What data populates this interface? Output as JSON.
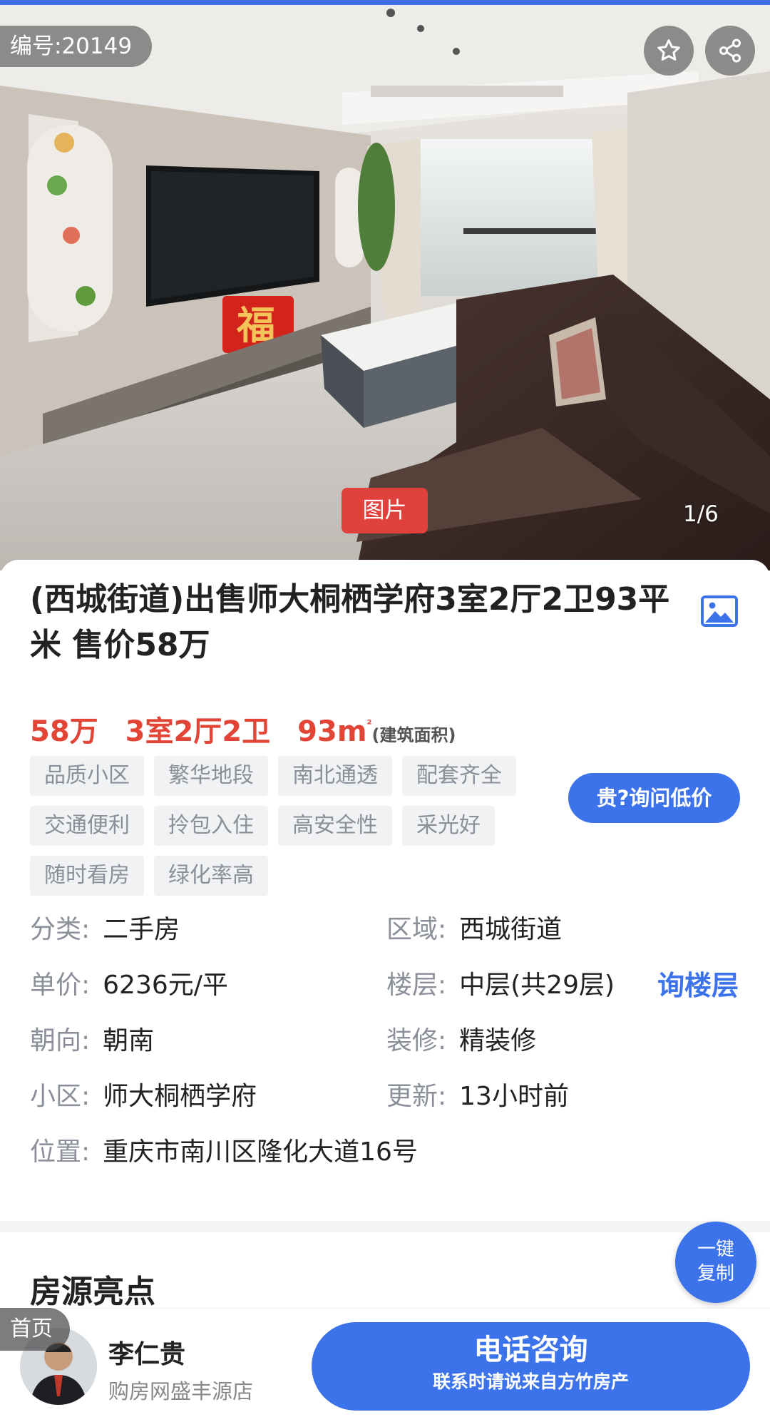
{
  "hero": {
    "listing_no": "编号:20149",
    "photo_tag": "图片",
    "photo_counter": "1/6",
    "decor_text": "福"
  },
  "listing": {
    "title": "(西城街道)出售师大桐栖学府3室2厅2卫93平米 售价58万",
    "price": "58万",
    "layout": "3室2厅2卫",
    "area": "93m",
    "area_sup": "²",
    "area_note": "(建筑面积)",
    "tags": [
      "品质小区",
      "繁华地段",
      "南北通透",
      "配套齐全",
      "交通便利",
      "拎包入住",
      "高安全性",
      "采光好",
      "随时看房",
      "绿化率高"
    ],
    "ask_price_label": "贵?询问低价"
  },
  "details": {
    "category_label": "分类:",
    "category": "二手房",
    "region_label": "区域:",
    "region": "西城街道",
    "unit_price_label": "单价:",
    "unit_price": "6236元/平",
    "floor_label": "楼层:",
    "floor": "中层(共29层)",
    "ask_floor": "询楼层",
    "orientation_label": "朝向:",
    "orientation": "朝南",
    "decoration_label": "装修:",
    "decoration": "精装修",
    "community_label": "小区:",
    "community": "师大桐栖学府",
    "updated_label": "更新:",
    "updated": "13小时前",
    "location_label": "位置:",
    "location": "重庆市南川区隆化大道16号"
  },
  "section": {
    "highlights_title": "房源亮点"
  },
  "copy_button": {
    "line1": "一键",
    "line2": "复制"
  },
  "bottom": {
    "home_label": "首页",
    "agent_name": "李仁贵",
    "agent_shop": "购房网盛丰源店",
    "call_main": "电话咨询",
    "call_sub": "联系时请说来自方竹房产"
  },
  "colors": {
    "accent": "#3d73ea",
    "price_red": "#e24535",
    "tag_bg": "#f1f2f4"
  }
}
